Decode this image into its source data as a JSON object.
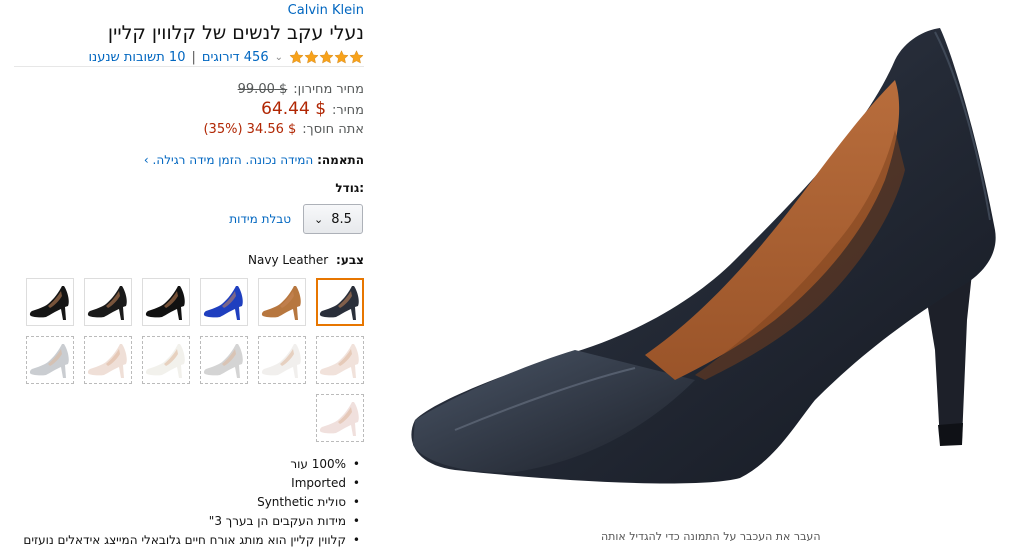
{
  "product": {
    "brand": "Calvin Klein",
    "title": "נעלי עקב לנשים של קלווין קליין",
    "rating_count": "456 דירוגים",
    "answered_questions": "10 תשובות שנענו",
    "star_color": "#f7a21b"
  },
  "price": {
    "list_label": "מחיר מחירון:",
    "list_value": "$ 99.00",
    "price_label": "מחיר:",
    "price_value": "$ 64.44",
    "save_label": "אתה חוסך:",
    "save_value": "$ 34.56 (35%)"
  },
  "fit": {
    "label": "התאמה:",
    "text": "המידה נכונה. הזמן מידה רגילה."
  },
  "size": {
    "label": "גודל:",
    "selected": "8.5",
    "chart_link": "טבלת מידות"
  },
  "color": {
    "label": "צבע:",
    "selected": "Navy Leather"
  },
  "swatches": [
    {
      "name": "navy-leather",
      "color": "#2a2f3a",
      "available": true,
      "selected": true
    },
    {
      "name": "cognac",
      "color": "#b7773f",
      "available": true
    },
    {
      "name": "cobalt",
      "color": "#1f3fbf",
      "available": true
    },
    {
      "name": "black-patent",
      "color": "#111111",
      "available": true
    },
    {
      "name": "black-leather",
      "color": "#1a1a1a",
      "available": true
    },
    {
      "name": "black-suede",
      "color": "#151515",
      "available": true
    },
    {
      "name": "blush",
      "color": "#e8cfc4",
      "available": false
    },
    {
      "name": "white",
      "color": "#e9e6e2",
      "available": false
    },
    {
      "name": "silver",
      "color": "#b9b9b9",
      "available": false
    },
    {
      "name": "ivory",
      "color": "#eae8e0",
      "available": false
    },
    {
      "name": "nude",
      "color": "#e6cbbd",
      "available": false
    },
    {
      "name": "grey",
      "color": "#a7adb4",
      "available": false
    },
    {
      "name": "pale-pink",
      "color": "#e7cdc7",
      "available": false
    }
  ],
  "bullets": [
    "100% עור",
    "Imported",
    "סולית Synthetic",
    "מידות העקבים הן בערך 3\"",
    "קלווין קליין הוא מותג אורח חיים גלובאלי המייצג אידאלים נועזים"
  ],
  "image_hint": "העבר את העכבר על התמונה כדי להגדיל אותה"
}
